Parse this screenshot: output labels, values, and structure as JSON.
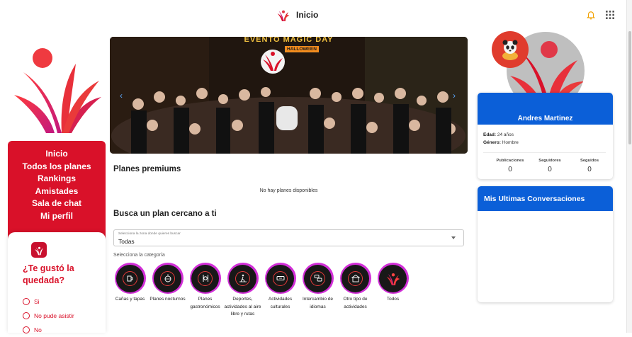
{
  "header": {
    "title": "Inicio",
    "icons": [
      "logo-icon",
      "bell-icon",
      "apps-grid-icon"
    ],
    "bell_color": "#f2a100"
  },
  "sidebar": {
    "items": [
      {
        "label": "Inicio"
      },
      {
        "label": "Todos los planes"
      },
      {
        "label": "Rankings"
      },
      {
        "label": "Amistades"
      },
      {
        "label": "Sala de chat"
      },
      {
        "label": "Mi perfil"
      }
    ],
    "color": "#d91129"
  },
  "feedback": {
    "question": "¿Te gustó la quedada?",
    "options": [
      {
        "label": "Si"
      },
      {
        "label": "No pude asistir"
      },
      {
        "label": "No"
      }
    ]
  },
  "hero": {
    "banner": "EVENTO MAGIC DAY",
    "badge": "HALLOWEEN",
    "prev": "‹",
    "next": "›"
  },
  "main": {
    "premium_title": "Planes premiums",
    "no_plans": "No hay planes disponibles",
    "near_title": "Busca un plan cercano a ti",
    "zone": {
      "label": "Selecciona la zona donde quieres buscar",
      "value": "Todas"
    },
    "category_label": "Selecciona la categoría",
    "categories": [
      {
        "label": "Cañas y tapas",
        "icon": "beer-icon"
      },
      {
        "label": "Planes nocturnos",
        "icon": "disco-ball-icon"
      },
      {
        "label": "Planes gastronómicos",
        "icon": "cutlery-icon"
      },
      {
        "label": "Deportes, actividades al aire libre y rutas",
        "icon": "hiking-icon"
      },
      {
        "label": "Actividades culturales",
        "icon": "ticket-icon"
      },
      {
        "label": "Intercambio de idiomas",
        "icon": "speech-bubbles-icon"
      },
      {
        "label": "Otro tipo de actividades",
        "icon": "building-icon"
      },
      {
        "label": "Todos",
        "icon": "logo-icon"
      }
    ]
  },
  "profile": {
    "name": "Andres Martinez",
    "age_label": "Edad:",
    "age_value": "24 años",
    "gender_label": "Género:",
    "gender_value": "Hombre",
    "stats": [
      {
        "label": "Publicaciones",
        "value": "0"
      },
      {
        "label": "Seguidores",
        "value": "0"
      },
      {
        "label": "Seguidos",
        "value": "0"
      }
    ],
    "header_color": "#0b5fd8"
  },
  "conversations": {
    "title": "Mis Ultimas Conversaciones"
  }
}
